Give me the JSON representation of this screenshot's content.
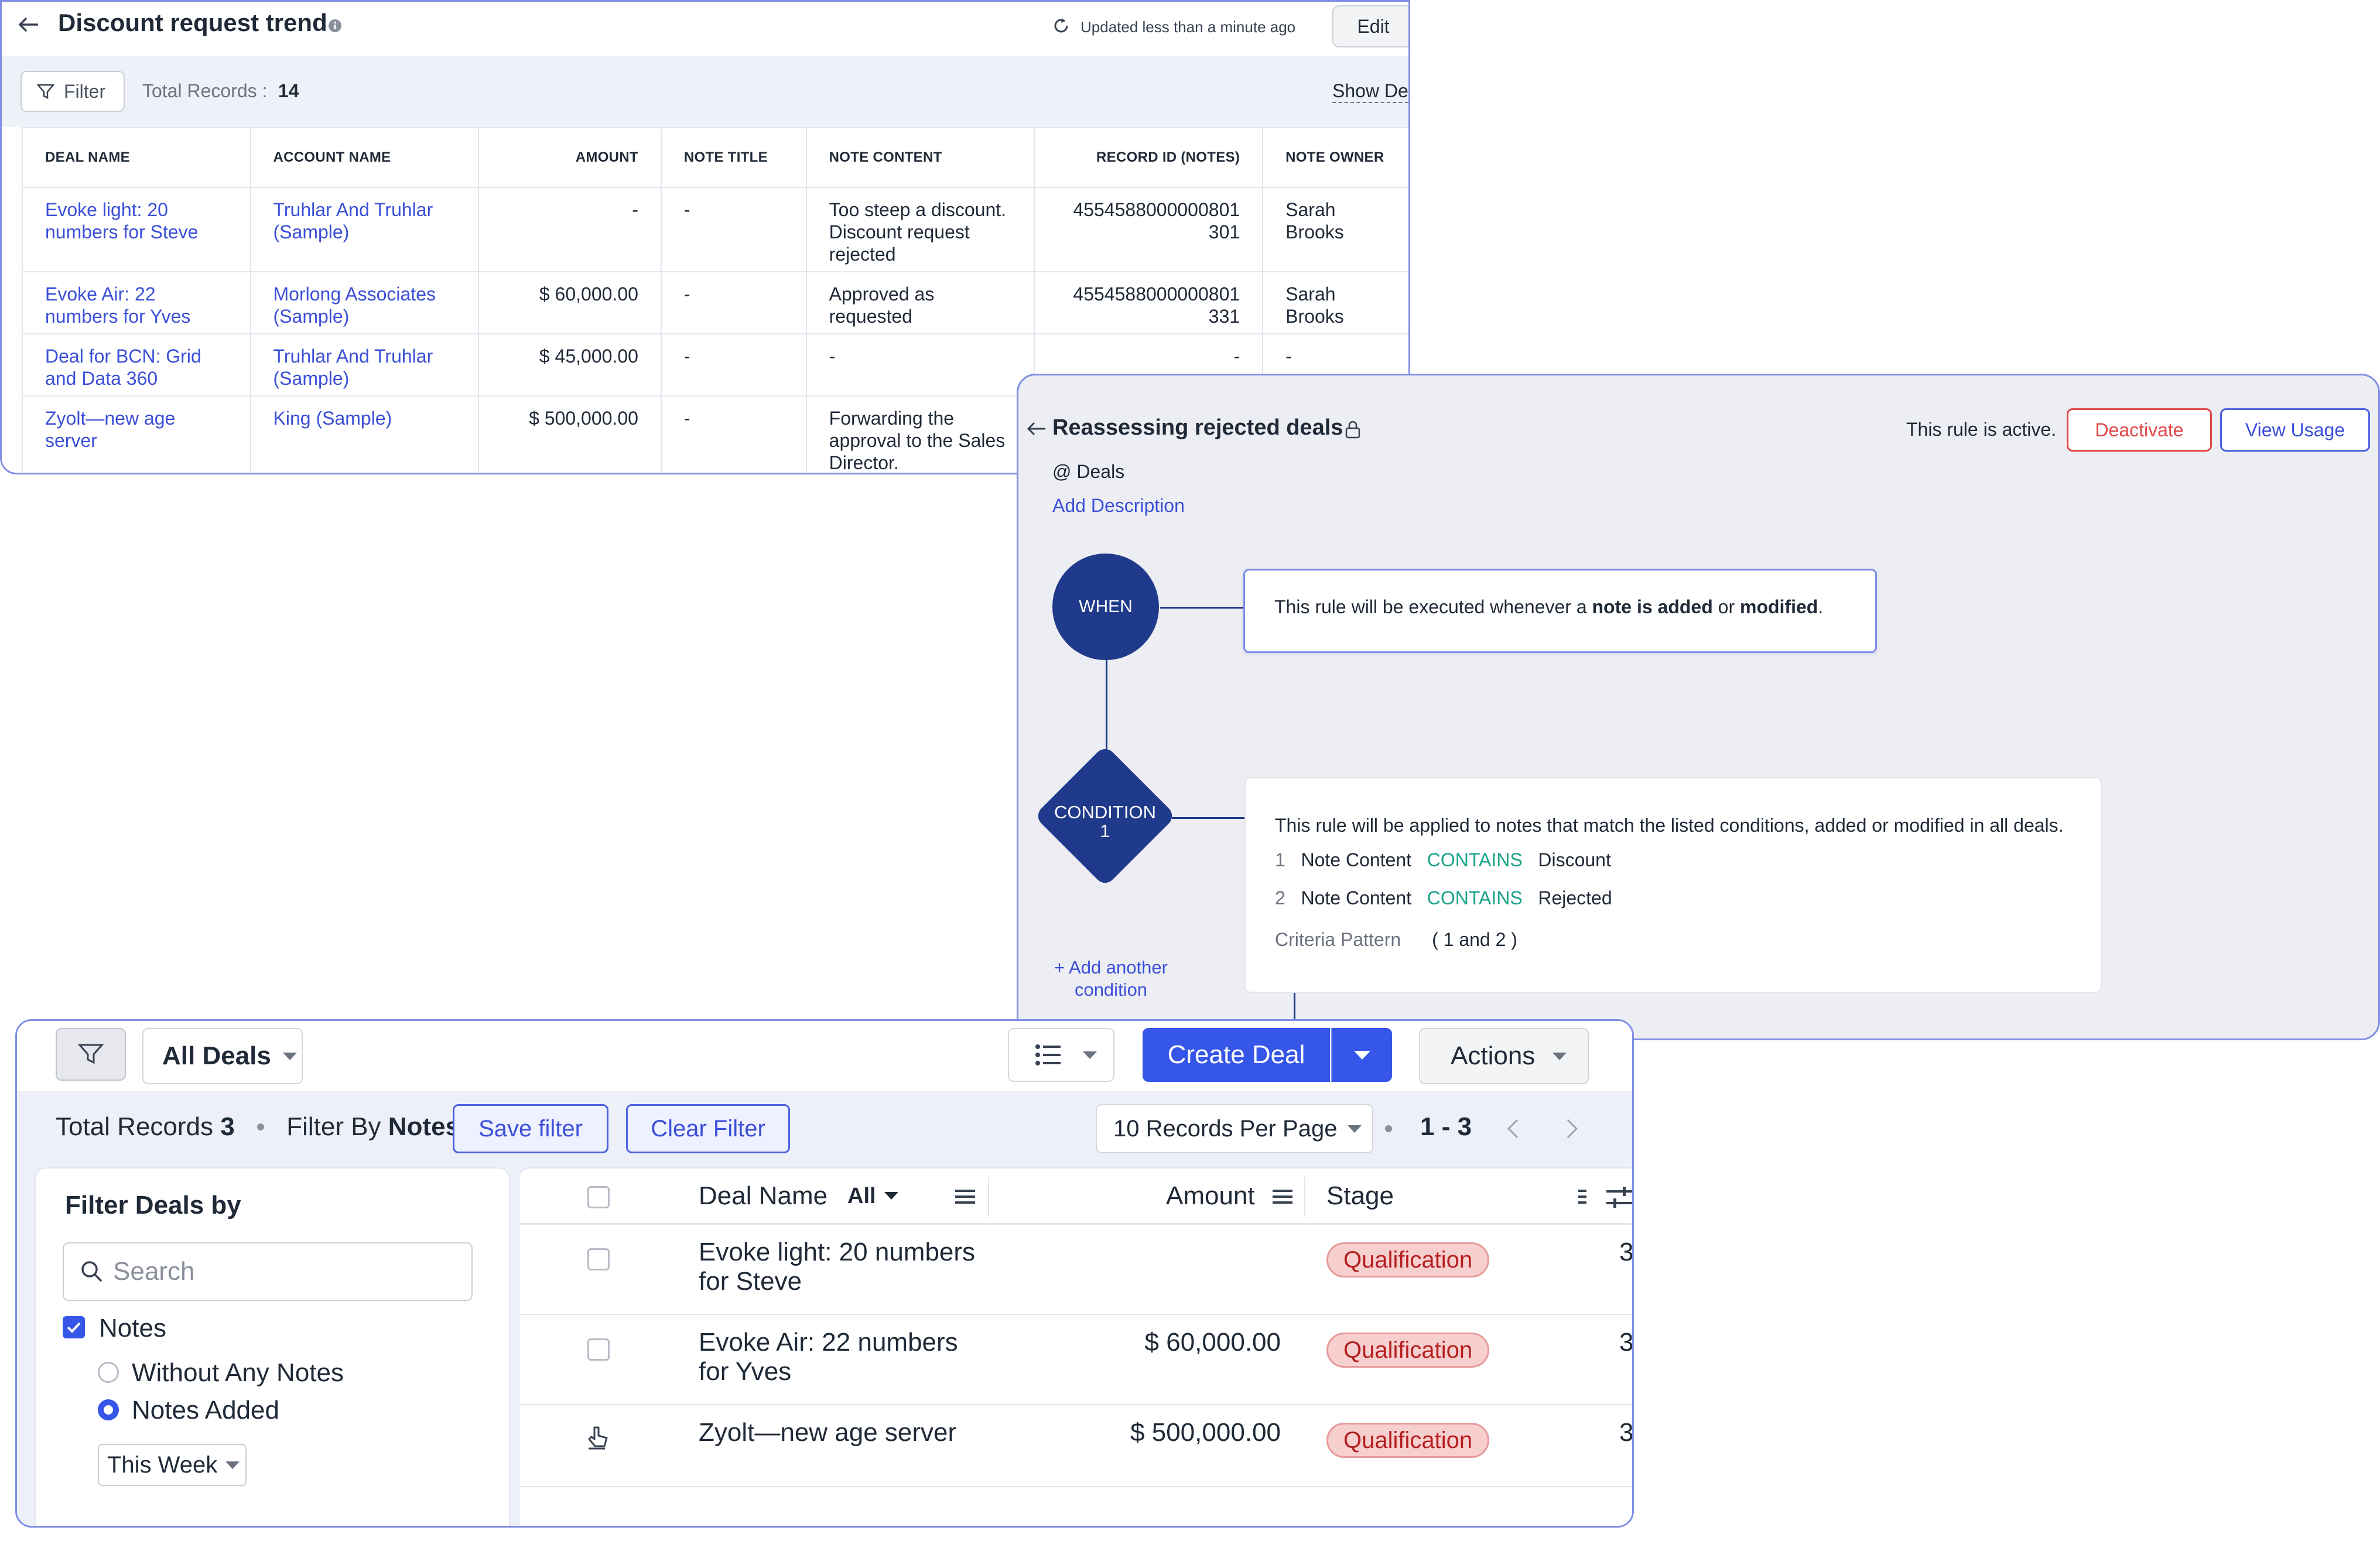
{
  "report": {
    "title": "Discount request trend",
    "updated_text": "Updated less than a minute ago",
    "edit_label": "Edit",
    "filter_label": "Filter",
    "total_records_label": "Total Records :",
    "total_records_value": "14",
    "show_details_label": "Show De",
    "columns": [
      "DEAL NAME",
      "ACCOUNT NAME",
      "AMOUNT",
      "NOTE TITLE",
      "NOTE CONTENT",
      "RECORD ID (NOTES)",
      "NOTE OWNER"
    ],
    "rows": [
      {
        "deal": "Evoke light: 20 numbers for Steve",
        "account": "Truhlar And Truhlar (Sample)",
        "amount": "-",
        "note_title": "-",
        "note_content": "Too steep a discount. Discount request rejected",
        "record_id": "4554588000000801 301",
        "owner": "Sarah Brooks"
      },
      {
        "deal": "Evoke Air: 22 numbers for Yves",
        "account": "Morlong Associates (Sample)",
        "amount": "$ 60,000.00",
        "note_title": "-",
        "note_content": "Approved as requested",
        "record_id": "4554588000000801 331",
        "owner": "Sarah Brooks"
      },
      {
        "deal": "Deal for BCN: Grid and Data 360",
        "account": "Truhlar And Truhlar (Sample)",
        "amount": "$ 45,000.00",
        "note_title": "-",
        "note_content": "-",
        "record_id": "-",
        "owner": "-"
      },
      {
        "deal": "Zyolt—new age server",
        "account": "King (Sample)",
        "amount": "$ 500,000.00",
        "note_title": "-",
        "note_content": "Forwarding the approval to the Sales Director.",
        "record_id": "",
        "owner": ""
      }
    ]
  },
  "rule": {
    "title": "Reassessing rejected deals",
    "module": "@ Deals",
    "add_description": "Add Description",
    "status_text": "This rule is active.",
    "deactivate_label": "Deactivate",
    "view_usage_label": "View Usage",
    "when_label": "WHEN",
    "when_text_1": "This rule will be executed whenever a ",
    "when_bold_1": "note is added",
    "when_text_2": " or ",
    "when_bold_2": "modified",
    "when_text_3": ".",
    "condition_label": "CONDITION",
    "condition_number": "1",
    "condition_intro": "This rule will be applied to notes that match the listed conditions, added or modified in all deals.",
    "conditions": [
      {
        "num": "1",
        "field": "Note Content",
        "op": "CONTAINS",
        "value": "Discount"
      },
      {
        "num": "2",
        "field": "Note Content",
        "op": "CONTAINS",
        "value": "Rejected"
      }
    ],
    "criteria_label": "Criteria Pattern",
    "criteria_value": "( 1 and 2 )",
    "add_condition_1": "+ Add another",
    "add_condition_2": "condition"
  },
  "deals": {
    "view_label": "All Deals",
    "create_label": "Create Deal",
    "actions_label": "Actions",
    "total_records_label": "Total Records",
    "total_records_value": "3",
    "filter_by_label": "Filter By",
    "filter_by_value": "Notes",
    "save_filter_label": "Save filter",
    "clear_filter_label": "Clear Filter",
    "per_page_label": "10 Records Per Page",
    "range_label": "1 - 3",
    "sidebar_title": "Filter Deals by",
    "search_placeholder": "Search",
    "notes_label": "Notes",
    "without_notes_label": "Without Any Notes",
    "notes_added_label": "Notes Added",
    "period_label": "This Week",
    "col_deal_name": "Deal Name",
    "col_all": "All",
    "col_amount": "Amount",
    "col_stage": "Stage",
    "rows": [
      {
        "name_1": "Evoke light: 20 numbers",
        "name_2": "for Steve",
        "amount": "",
        "stage": "Qualification",
        "extra": "3"
      },
      {
        "name_1": "Evoke Air: 22 numbers",
        "name_2": "for Yves",
        "amount": "$ 60,000.00",
        "stage": "Qualification",
        "extra": "3"
      },
      {
        "name_1": "Zyolt—new age server",
        "name_2": "",
        "amount": "$ 500,000.00",
        "stage": "Qualification",
        "extra": "3"
      }
    ]
  },
  "colors": {
    "accent": "#3b4fd8",
    "rule_node": "#1f3a8a",
    "danger": "#e04848",
    "contains": "#1aa38a",
    "tag_bg": "#f8cfcf"
  }
}
